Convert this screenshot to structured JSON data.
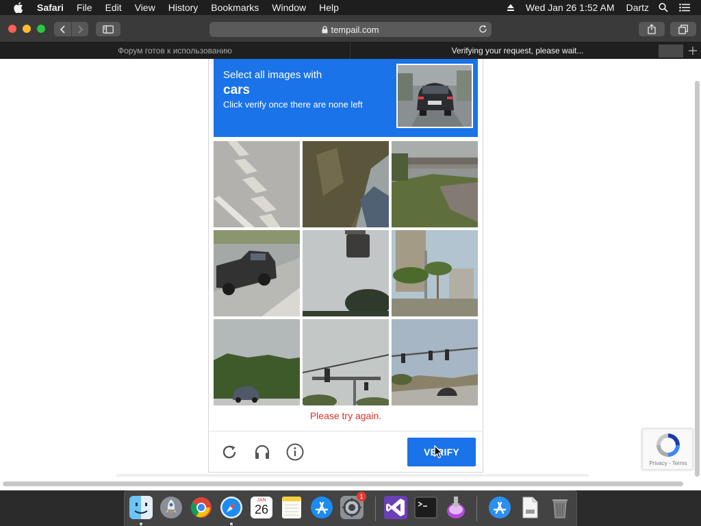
{
  "menubar": {
    "app_name": "Safari",
    "items": [
      "File",
      "Edit",
      "View",
      "History",
      "Bookmarks",
      "Window",
      "Help"
    ],
    "clock": "Wed Jan 26  1:52 AM",
    "user": "Dartz"
  },
  "toolbar": {
    "url": "tempail.com"
  },
  "tabs": [
    {
      "title": "Форум готов к использованию",
      "active": false
    },
    {
      "title": "Verifying your request, please wait...",
      "active": true
    }
  ],
  "captcha": {
    "prompt_line1": "Select all images with",
    "keyword": "cars",
    "prompt_line3": "Click verify once there are none left",
    "error": "Please try again.",
    "verify_label": "VERIFY",
    "accent_color": "#1a73e8",
    "error_color": "#d93025",
    "tiles": [
      {
        "name": "tile-crosswalk-stripes"
      },
      {
        "name": "tile-tree-trunk"
      },
      {
        "name": "tile-overpass-grass"
      },
      {
        "name": "tile-pickup-truck"
      },
      {
        "name": "tile-traffic-light-sky"
      },
      {
        "name": "tile-buildings-palms"
      },
      {
        "name": "tile-trees-with-car"
      },
      {
        "name": "tile-traffic-signal-pole"
      },
      {
        "name": "tile-intersection-car"
      }
    ]
  },
  "recaptcha": {
    "links": "Privacy - Terms"
  },
  "dock": {
    "apps": [
      "Finder",
      "Launchpad",
      "Chrome",
      "Safari",
      "Calendar",
      "Notes",
      "App Store",
      "System Preferences",
      "Visual Studio",
      "Terminal",
      "Installer",
      "App Store Downloads",
      "Documents",
      "Trash"
    ],
    "calendar_month": "JAN",
    "calendar_day": "26",
    "system_prefs_badge": "1"
  }
}
